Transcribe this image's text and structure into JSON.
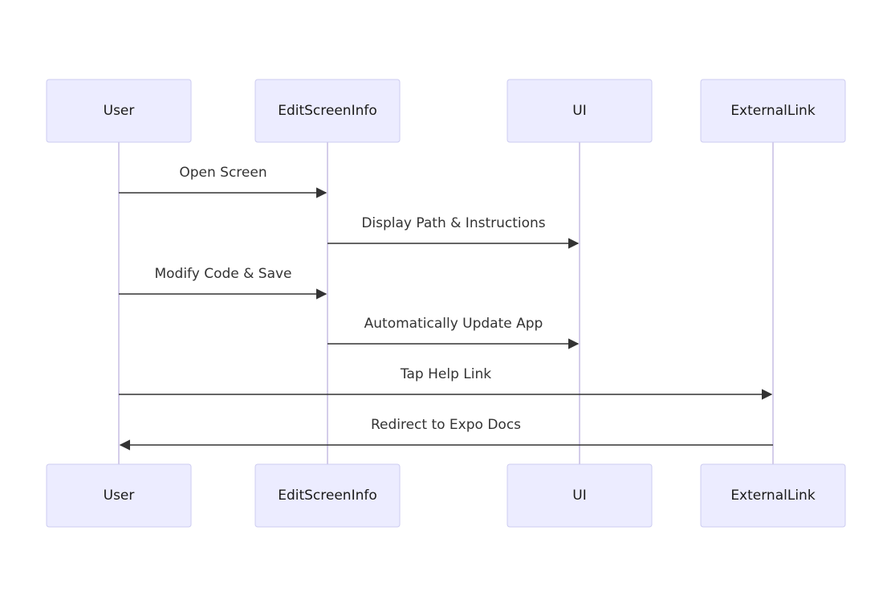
{
  "participants": [
    {
      "id": "user",
      "label": "User"
    },
    {
      "id": "edit",
      "label": "EditScreenInfo"
    },
    {
      "id": "ui",
      "label": "UI"
    },
    {
      "id": "ext",
      "label": "ExternalLink"
    }
  ],
  "messages": [
    {
      "from": "user",
      "to": "edit",
      "label": "Open Screen"
    },
    {
      "from": "edit",
      "to": "ui",
      "label": "Display Path & Instructions"
    },
    {
      "from": "user",
      "to": "edit",
      "label": "Modify Code & Save"
    },
    {
      "from": "edit",
      "to": "ui",
      "label": "Automatically Update App"
    },
    {
      "from": "user",
      "to": "ext",
      "label": "Tap Help Link"
    },
    {
      "from": "ext",
      "to": "user",
      "label": "Redirect to Expo Docs"
    }
  ],
  "colors": {
    "box_fill": "#ececff",
    "box_stroke": "#cccbf0",
    "lifeline": "#d4cdea",
    "arrow": "#333333",
    "text": "#1a1a1a"
  }
}
